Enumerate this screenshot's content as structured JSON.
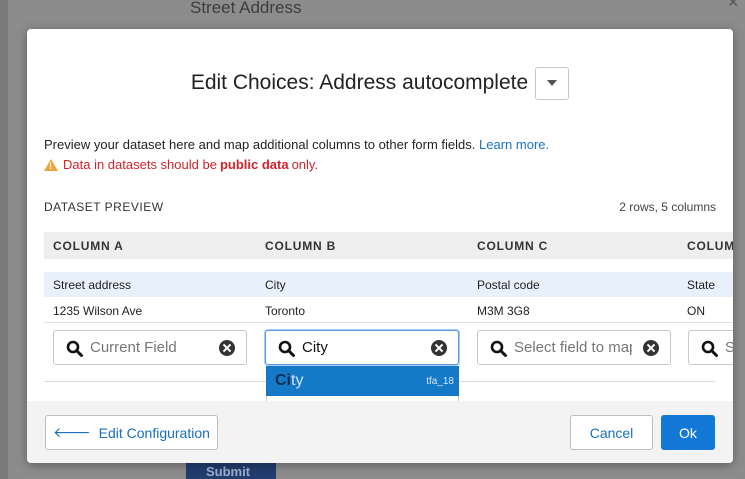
{
  "background": {
    "street_address_label": "Street Address",
    "submit_label": "Submit"
  },
  "modal": {
    "title": "Edit Choices: Address autocomplete",
    "description": "Preview your dataset here and map additional columns to other form fields.",
    "learn_more": "Learn more.",
    "warning": {
      "prefix": "Data in datasets should be",
      "bold": "public data",
      "suffix": "only."
    },
    "section_label": "DATASET PREVIEW",
    "row_count": "2 rows, 5 columns",
    "columns": [
      "COLUMN A",
      "COLUMN B",
      "COLUMN C",
      "COLUMN D"
    ],
    "rows": [
      [
        "Street address",
        "City",
        "Postal code",
        "State"
      ],
      [
        "1235 Wilson Ave",
        "Toronto",
        "M3M 3G8",
        "ON"
      ]
    ],
    "mappings": [
      {
        "placeholder": "Current Field",
        "value": ""
      },
      {
        "placeholder": "",
        "value": "City"
      },
      {
        "placeholder": "Select field to map",
        "value": ""
      },
      {
        "placeholder": "Select field to map",
        "value": ""
      }
    ],
    "dropdown": {
      "match": "Ci",
      "rest": "ty",
      "tag": "tfa_18"
    },
    "footer": {
      "edit_config": "Edit Configuration",
      "cancel": "Cancel",
      "ok": "Ok"
    }
  },
  "colors": {
    "accent": "#1479d6",
    "link": "#1a73c9",
    "warning_text": "#d1232a",
    "warning_icon": "#f0a33c",
    "highlight_row": "#e8f1fb",
    "dropdown_selected": "#1479c6"
  },
  "icons": {
    "dropdown_caret": "caret-down-icon",
    "warning": "warning-triangle-icon",
    "search": "magnifier-icon",
    "clear": "clear-circle-x-icon",
    "back": "arrow-left-icon"
  }
}
